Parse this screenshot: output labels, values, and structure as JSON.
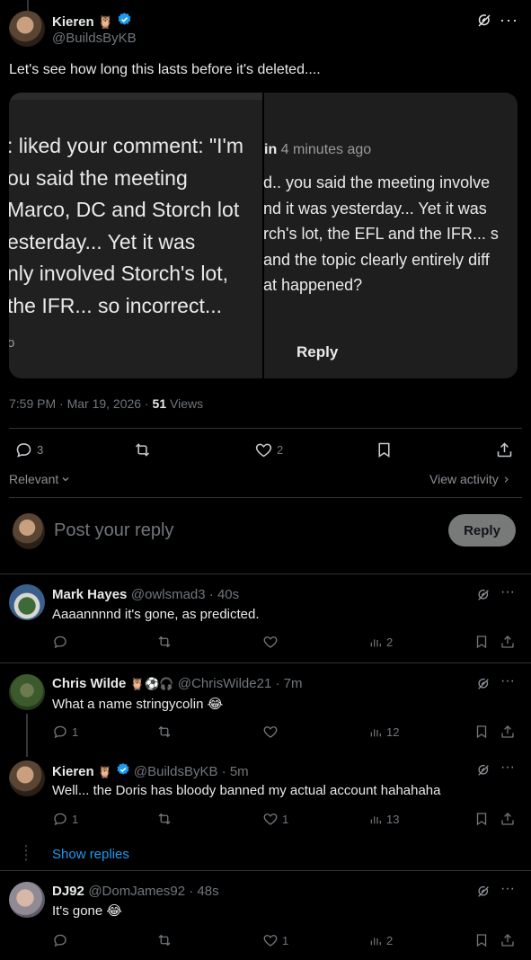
{
  "main_post": {
    "name": "Kieren",
    "emoji": "🦉",
    "handle": "@BuildsByKB",
    "text": "Let's see how long this lasts before it's deleted....",
    "timestamp": "7:59 PM · Mar 19, 2026 · ",
    "views_count": "51",
    "views_label": " Views",
    "image_left_lines": [
      ": liked your comment: \"I'm",
      "ou said the meeting",
      "Marco, DC and Storch lot",
      "esterday... Yet it was",
      "nly involved Storch's lot,",
      "the IFR... so incorrect...",
      "o"
    ],
    "image_right_header_name": "in",
    "image_right_header_time": " 4 minutes ago",
    "image_right_lines": [
      "d.. you said the meeting involve",
      "nd it was yesterday... Yet it was",
      "rch's lot, the EFL and the IFR... s",
      "and the topic clearly entirely diff",
      "at happened?"
    ],
    "image_right_reply": "Reply",
    "stats": {
      "replies": "3",
      "reposts": "",
      "likes": "2"
    }
  },
  "sort": {
    "label": "Relevant",
    "view_activity": "View activity"
  },
  "composer": {
    "placeholder": "Post your reply",
    "button": "Reply"
  },
  "replies": [
    {
      "name": "Mark Hayes",
      "handle": "@owlsmad3",
      "time": " · 40s",
      "text": "Aaaannnnd it's gone, as predicted.",
      "replies": "",
      "likes": "",
      "views": "2"
    },
    {
      "name": "Chris Wilde",
      "emojis": "🦉⚽🎧",
      "handle": "@ChrisWilde21",
      "time": " · 7m",
      "text": "What a name stringycolin 😂",
      "replies": "1",
      "likes": "",
      "views": "12"
    },
    {
      "name": "Kieren",
      "emoji": "🦉",
      "handle": "@BuildsByKB",
      "time": " · 5m",
      "text": "Well... the Doris has bloody banned my actual account hahahaha",
      "replies": "1",
      "likes": "1",
      "views": "13"
    },
    {
      "name": "DJ92",
      "handle": "@DomJames92",
      "time": " · 48s",
      "text": "It's gone 😂",
      "replies": "",
      "likes": "1",
      "views": "2"
    }
  ],
  "show_replies": "Show replies",
  "colors": {
    "accent": "#1d9bf0",
    "verified": "#1d9bf0",
    "background": "#000000",
    "border": "#2f3336"
  }
}
